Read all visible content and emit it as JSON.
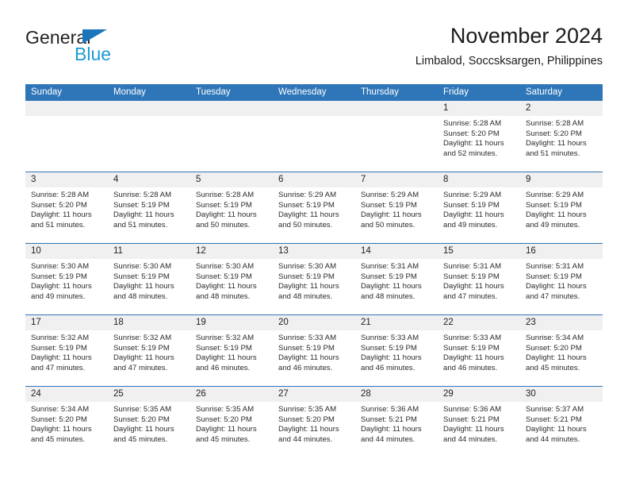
{
  "brand": {
    "name_part1": "General",
    "name_part2": "Blue",
    "triangle_icon": "blue-triangle-icon",
    "accent_color": "#1b75bb",
    "accent_color_light": "#1b9ad6"
  },
  "header": {
    "title": "November 2024",
    "subtitle": "Limbalod, Soccsksargen, Philippines"
  },
  "theme": {
    "header_blue": "#2f76b8",
    "date_band": "#f0f0f0",
    "text": "#222222"
  },
  "weekdays": [
    "Sunday",
    "Monday",
    "Tuesday",
    "Wednesday",
    "Thursday",
    "Friday",
    "Saturday"
  ],
  "labels": {
    "sunrise": "Sunrise:",
    "sunset": "Sunset:",
    "daylight": "Daylight:"
  },
  "weeks": [
    [
      {
        "date": ""
      },
      {
        "date": ""
      },
      {
        "date": ""
      },
      {
        "date": ""
      },
      {
        "date": ""
      },
      {
        "date": "1",
        "sunrise": "Sunrise: 5:28 AM",
        "sunset": "Sunset: 5:20 PM",
        "daylight": "Daylight: 11 hours and 52 minutes."
      },
      {
        "date": "2",
        "sunrise": "Sunrise: 5:28 AM",
        "sunset": "Sunset: 5:20 PM",
        "daylight": "Daylight: 11 hours and 51 minutes."
      }
    ],
    [
      {
        "date": "3",
        "sunrise": "Sunrise: 5:28 AM",
        "sunset": "Sunset: 5:20 PM",
        "daylight": "Daylight: 11 hours and 51 minutes."
      },
      {
        "date": "4",
        "sunrise": "Sunrise: 5:28 AM",
        "sunset": "Sunset: 5:19 PM",
        "daylight": "Daylight: 11 hours and 51 minutes."
      },
      {
        "date": "5",
        "sunrise": "Sunrise: 5:28 AM",
        "sunset": "Sunset: 5:19 PM",
        "daylight": "Daylight: 11 hours and 50 minutes."
      },
      {
        "date": "6",
        "sunrise": "Sunrise: 5:29 AM",
        "sunset": "Sunset: 5:19 PM",
        "daylight": "Daylight: 11 hours and 50 minutes."
      },
      {
        "date": "7",
        "sunrise": "Sunrise: 5:29 AM",
        "sunset": "Sunset: 5:19 PM",
        "daylight": "Daylight: 11 hours and 50 minutes."
      },
      {
        "date": "8",
        "sunrise": "Sunrise: 5:29 AM",
        "sunset": "Sunset: 5:19 PM",
        "daylight": "Daylight: 11 hours and 49 minutes."
      },
      {
        "date": "9",
        "sunrise": "Sunrise: 5:29 AM",
        "sunset": "Sunset: 5:19 PM",
        "daylight": "Daylight: 11 hours and 49 minutes."
      }
    ],
    [
      {
        "date": "10",
        "sunrise": "Sunrise: 5:30 AM",
        "sunset": "Sunset: 5:19 PM",
        "daylight": "Daylight: 11 hours and 49 minutes."
      },
      {
        "date": "11",
        "sunrise": "Sunrise: 5:30 AM",
        "sunset": "Sunset: 5:19 PM",
        "daylight": "Daylight: 11 hours and 48 minutes."
      },
      {
        "date": "12",
        "sunrise": "Sunrise: 5:30 AM",
        "sunset": "Sunset: 5:19 PM",
        "daylight": "Daylight: 11 hours and 48 minutes."
      },
      {
        "date": "13",
        "sunrise": "Sunrise: 5:30 AM",
        "sunset": "Sunset: 5:19 PM",
        "daylight": "Daylight: 11 hours and 48 minutes."
      },
      {
        "date": "14",
        "sunrise": "Sunrise: 5:31 AM",
        "sunset": "Sunset: 5:19 PM",
        "daylight": "Daylight: 11 hours and 48 minutes."
      },
      {
        "date": "15",
        "sunrise": "Sunrise: 5:31 AM",
        "sunset": "Sunset: 5:19 PM",
        "daylight": "Daylight: 11 hours and 47 minutes."
      },
      {
        "date": "16",
        "sunrise": "Sunrise: 5:31 AM",
        "sunset": "Sunset: 5:19 PM",
        "daylight": "Daylight: 11 hours and 47 minutes."
      }
    ],
    [
      {
        "date": "17",
        "sunrise": "Sunrise: 5:32 AM",
        "sunset": "Sunset: 5:19 PM",
        "daylight": "Daylight: 11 hours and 47 minutes."
      },
      {
        "date": "18",
        "sunrise": "Sunrise: 5:32 AM",
        "sunset": "Sunset: 5:19 PM",
        "daylight": "Daylight: 11 hours and 47 minutes."
      },
      {
        "date": "19",
        "sunrise": "Sunrise: 5:32 AM",
        "sunset": "Sunset: 5:19 PM",
        "daylight": "Daylight: 11 hours and 46 minutes."
      },
      {
        "date": "20",
        "sunrise": "Sunrise: 5:33 AM",
        "sunset": "Sunset: 5:19 PM",
        "daylight": "Daylight: 11 hours and 46 minutes."
      },
      {
        "date": "21",
        "sunrise": "Sunrise: 5:33 AM",
        "sunset": "Sunset: 5:19 PM",
        "daylight": "Daylight: 11 hours and 46 minutes."
      },
      {
        "date": "22",
        "sunrise": "Sunrise: 5:33 AM",
        "sunset": "Sunset: 5:19 PM",
        "daylight": "Daylight: 11 hours and 46 minutes."
      },
      {
        "date": "23",
        "sunrise": "Sunrise: 5:34 AM",
        "sunset": "Sunset: 5:20 PM",
        "daylight": "Daylight: 11 hours and 45 minutes."
      }
    ],
    [
      {
        "date": "24",
        "sunrise": "Sunrise: 5:34 AM",
        "sunset": "Sunset: 5:20 PM",
        "daylight": "Daylight: 11 hours and 45 minutes."
      },
      {
        "date": "25",
        "sunrise": "Sunrise: 5:35 AM",
        "sunset": "Sunset: 5:20 PM",
        "daylight": "Daylight: 11 hours and 45 minutes."
      },
      {
        "date": "26",
        "sunrise": "Sunrise: 5:35 AM",
        "sunset": "Sunset: 5:20 PM",
        "daylight": "Daylight: 11 hours and 45 minutes."
      },
      {
        "date": "27",
        "sunrise": "Sunrise: 5:35 AM",
        "sunset": "Sunset: 5:20 PM",
        "daylight": "Daylight: 11 hours and 44 minutes."
      },
      {
        "date": "28",
        "sunrise": "Sunrise: 5:36 AM",
        "sunset": "Sunset: 5:21 PM",
        "daylight": "Daylight: 11 hours and 44 minutes."
      },
      {
        "date": "29",
        "sunrise": "Sunrise: 5:36 AM",
        "sunset": "Sunset: 5:21 PM",
        "daylight": "Daylight: 11 hours and 44 minutes."
      },
      {
        "date": "30",
        "sunrise": "Sunrise: 5:37 AM",
        "sunset": "Sunset: 5:21 PM",
        "daylight": "Daylight: 11 hours and 44 minutes."
      }
    ]
  ]
}
